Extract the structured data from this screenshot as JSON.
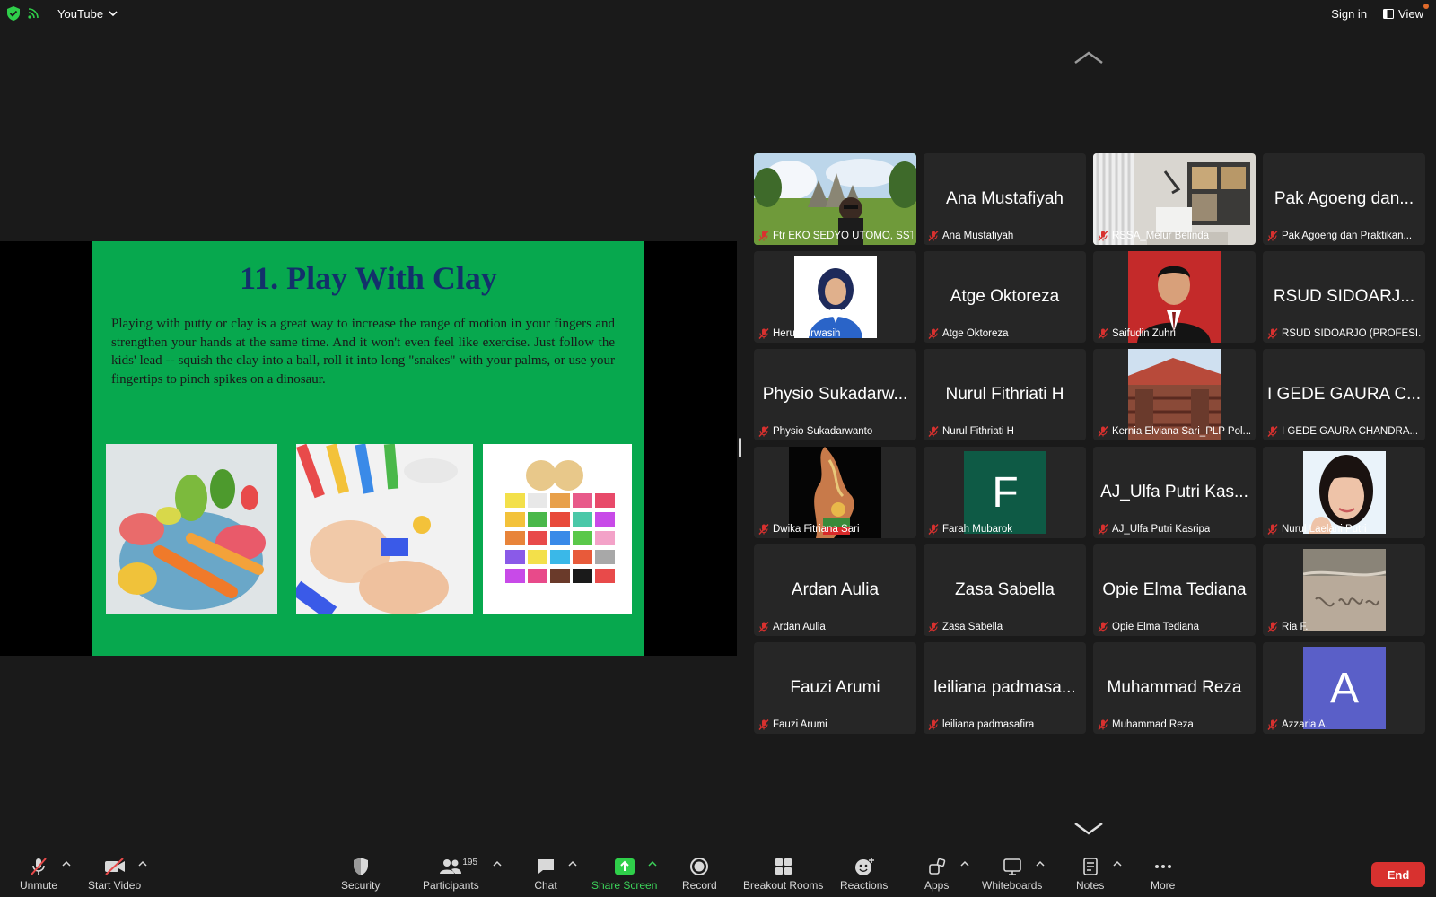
{
  "topbar": {
    "app_name": "YouTube",
    "sign_in": "Sign in",
    "view": "View"
  },
  "slide": {
    "title": "11.  Play With Clay",
    "body": "Playing with putty or clay is a great way to increase the range of motion in your fingers and strengthen your hands at the same time. And it won't even feel like exercise. Just follow the kids' lead -- squish the clay into a ball, roll it into long \"snakes\" with your palms, or use your fingertips to pinch spikes on a dinosaur."
  },
  "participants": [
    {
      "big": "",
      "label": "Ftr EKO SEDYO UTOMO, SST",
      "kind": "photo-park",
      "active": true
    },
    {
      "big": "Ana Mustafiyah",
      "label": "Ana Mustafiyah",
      "kind": "name"
    },
    {
      "big": "",
      "label": "RSSA_Melur Belinda",
      "kind": "photo-room"
    },
    {
      "big": "Pak Agoeng dan...",
      "label": "Pak Agoeng dan Praktikan...",
      "kind": "name"
    },
    {
      "big": "",
      "label": "Heru Purwasih",
      "kind": "photo-hijab"
    },
    {
      "big": "Atge Oktoreza",
      "label": "Atge Oktoreza",
      "kind": "name"
    },
    {
      "big": "",
      "label": "Saifudin Zuhri",
      "kind": "photo-suit"
    },
    {
      "big": "RSUD SIDOARJ...",
      "label": "RSUD SIDOARJO (PROFESI...",
      "kind": "name"
    },
    {
      "big": "Physio Sukadarw...",
      "label": "Physio Sukadarwanto",
      "kind": "name"
    },
    {
      "big": "Nurul Fithriati H",
      "label": "Nurul Fithriati H",
      "kind": "name"
    },
    {
      "big": "",
      "label": "Kernia Elviana Sari_PLP Pol...",
      "kind": "photo-building"
    },
    {
      "big": "I GEDE GAURA C...",
      "label": "I GEDE GAURA CHANDRA...",
      "kind": "name"
    },
    {
      "big": "",
      "label": "Dwika Fitriana Sari",
      "kind": "photo-dark"
    },
    {
      "big": "F",
      "label": "Farah Mubarok",
      "kind": "letter",
      "color": "#0e5a45"
    },
    {
      "big": "AJ_Ulfa Putri Kas...",
      "label": "AJ_Ulfa Putri Kasripa",
      "kind": "name"
    },
    {
      "big": "",
      "label": "Nurul Laelani Putri",
      "kind": "photo-woman"
    },
    {
      "big": "Ardan Aulia",
      "label": "Ardan Aulia",
      "kind": "name"
    },
    {
      "big": "Zasa Sabella",
      "label": "Zasa Sabella",
      "kind": "name"
    },
    {
      "big": "Opie Elma Tediana",
      "label": "Opie Elma Tediana",
      "kind": "name"
    },
    {
      "big": "",
      "label": "Ria F.",
      "kind": "photo-sand"
    },
    {
      "big": "Fauzi Arumi",
      "label": "Fauzi Arumi",
      "kind": "name"
    },
    {
      "big": "leiliana padmasa...",
      "label": "leiliana padmasafira",
      "kind": "name"
    },
    {
      "big": "Muhammad Reza",
      "label": "Muhammad Reza",
      "kind": "name"
    },
    {
      "big": "A",
      "label": "Azzaria A.",
      "kind": "letter",
      "color": "#5a5fc8"
    }
  ],
  "toolbar": {
    "unmute": "Unmute",
    "start_video": "Start Video",
    "security": "Security",
    "participants": "Participants",
    "participants_count": "195",
    "chat": "Chat",
    "share_screen": "Share Screen",
    "record": "Record",
    "breakout_rooms": "Breakout Rooms",
    "reactions": "Reactions",
    "apps": "Apps",
    "whiteboards": "Whiteboards",
    "notes": "Notes",
    "more": "More",
    "end": "End"
  },
  "colors": {
    "active_border": "#2fcf4a",
    "end": "#d8312f",
    "slide_bg": "#07a84e",
    "share_green": "#3cd35a"
  }
}
